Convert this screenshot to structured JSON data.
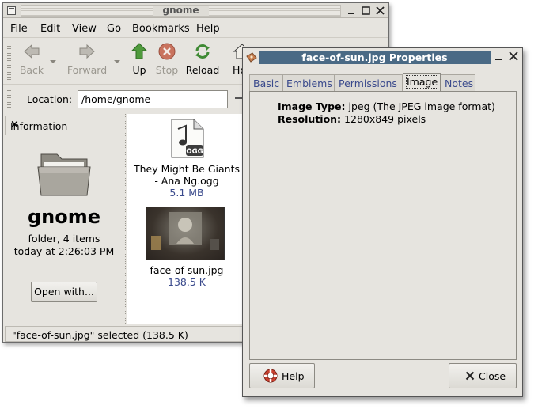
{
  "nautilus": {
    "title": "gnome",
    "menu": [
      "File",
      "Edit",
      "View",
      "Go",
      "Bookmarks",
      "Help"
    ],
    "toolbar": {
      "back": "Back",
      "forward": "Forward",
      "up": "Up",
      "stop": "Stop",
      "reload": "Reload",
      "home": "Ho"
    },
    "location": {
      "label": "Location:",
      "value": "/home/gnome"
    },
    "sidebar": {
      "header": "Information",
      "close": "×",
      "name": "gnome",
      "type_line": "folder, 4 items",
      "date_line": "today at 2:26:03 PM",
      "open_with": "Open with..."
    },
    "files": [
      {
        "name_line1": "They Might Be Giants",
        "name_line2": "- Ana Ng.ogg",
        "size": "5.1 MB",
        "badge": "OGG"
      },
      {
        "name_line1": "face-of-sun.jpg",
        "size": "138.5 K"
      }
    ],
    "status": "\"face-of-sun.jpg\" selected (138.5 K)"
  },
  "dialog": {
    "title": "face-of-sun.jpg Properties",
    "tabs": [
      "Basic",
      "Emblems",
      "Permissions",
      "Image",
      "Notes"
    ],
    "active_tab": "Image",
    "properties": [
      {
        "label": "Image Type:",
        "value": "jpeg (The JPEG image format)"
      },
      {
        "label": "Resolution:",
        "value": "1280x849 pixels"
      }
    ],
    "help_button": "Help",
    "close_button": "Close"
  },
  "colors": {
    "window_bg": "#e6e4df",
    "dialog_title_bg": "#4a6a85",
    "link_blue": "#3a4a8c"
  }
}
